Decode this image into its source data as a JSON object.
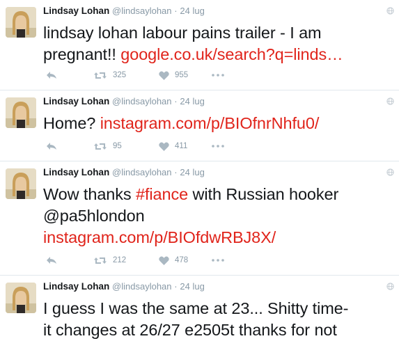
{
  "colors": {
    "link": "#e0241b",
    "meta": "#8899a6",
    "icon": "#aab8c2",
    "divider": "#e1e8ed"
  },
  "tweets": [
    {
      "author_name": "Lindsay Lohan",
      "handle": "@lindsaylohan",
      "separator": "·",
      "date": "24 lug",
      "lines": [
        {
          "text": "lindsay lohan labour pains trailer - I am",
          "link": ""
        },
        {
          "text": "pregnant!! ",
          "link": "google.co.uk/search?q=linds…"
        }
      ],
      "retweets": "325",
      "likes": "955"
    },
    {
      "author_name": "Lindsay Lohan",
      "handle": "@lindsaylohan",
      "separator": "·",
      "date": "24 lug",
      "lines": [
        {
          "text": "Home? ",
          "link": "instagram.com/p/BIOfnrNhfu0/"
        }
      ],
      "retweets": "95",
      "likes": "411"
    },
    {
      "author_name": "Lindsay Lohan",
      "handle": "@lindsaylohan",
      "separator": "·",
      "date": "24 lug",
      "lines": [
        {
          "text": "Wow thanks ",
          "link": "#fiance",
          "after": " with Russian hooker"
        },
        {
          "text": "@pa5hlondon",
          "link": ""
        },
        {
          "text": "",
          "link": "instagram.com/p/BIOfdwRBJ8X/"
        }
      ],
      "retweets": "212",
      "likes": "478"
    },
    {
      "author_name": "Lindsay Lohan",
      "handle": "@lindsaylohan",
      "separator": "·",
      "date": "24 lug",
      "lines": [
        {
          "text": "I guess I was the same at 23... Shitty time-",
          "link": ""
        },
        {
          "text": "it changes at 26/27  e2505t thanks for not",
          "link": ""
        }
      ]
    }
  ],
  "icons": {
    "reply": "reply-icon",
    "retweet": "retweet-icon",
    "like": "heart-icon",
    "more": "more-icon",
    "globe": "globe-icon"
  }
}
